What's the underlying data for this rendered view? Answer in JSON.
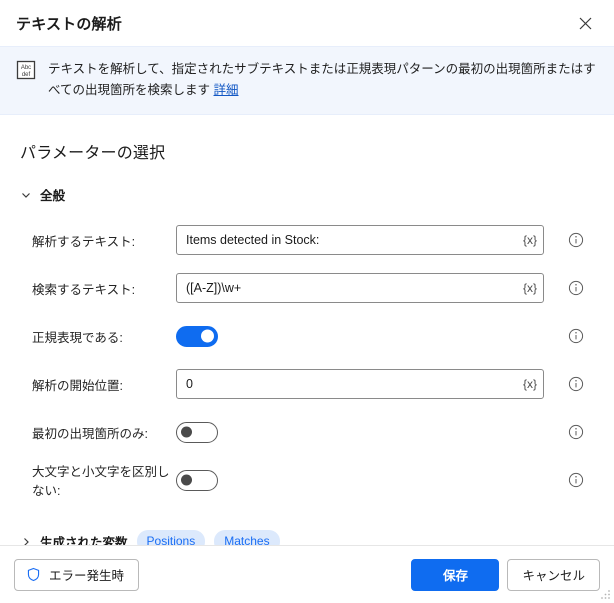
{
  "window": {
    "title": "テキストの解析",
    "close_label": "×"
  },
  "banner": {
    "icon": "parse-text-icon",
    "icon_top": "Abc",
    "icon_bottom": "def",
    "text": "テキストを解析して、指定されたサブテキストまたは正規表現パターンの最初の出現箇所またはすべての出現箇所を検索します",
    "link_label": "詳細"
  },
  "main": {
    "section_heading": "パラメーターの選択",
    "group": {
      "label": "全般",
      "expanded": true
    },
    "rows": [
      {
        "label": "解析するテキスト:",
        "type": "text",
        "value": "Items detected in Stock:",
        "var_button": "{x}",
        "info": "i"
      },
      {
        "label": "検索するテキスト:",
        "type": "text",
        "value": "([A-Z])\\w+",
        "var_button": "{x}",
        "info": "i"
      },
      {
        "label": "正規表現である:",
        "type": "toggle",
        "state": "on",
        "info": "i"
      },
      {
        "label": "解析の開始位置:",
        "type": "text",
        "value": "0",
        "var_button": "{x}",
        "info": "i"
      },
      {
        "label": "最初の出現箇所のみ:",
        "type": "toggle",
        "state": "off",
        "info": "i"
      },
      {
        "label": "大文字と小文字を区別しない:",
        "type": "toggle",
        "state": "off",
        "info": "i"
      }
    ],
    "generated_variables": {
      "label": "生成された変数",
      "expanded": false,
      "badges": [
        "Positions",
        "Matches"
      ]
    }
  },
  "footer": {
    "on_error_label": "エラー発生時",
    "save_label": "保存",
    "cancel_label": "キャンセル"
  },
  "colors": {
    "accent": "#0f6cf0",
    "badge_bg": "#dce9fc",
    "badge_text": "#1b6ef3",
    "banner_bg": "#f2f6fd",
    "link": "#1257c4"
  }
}
